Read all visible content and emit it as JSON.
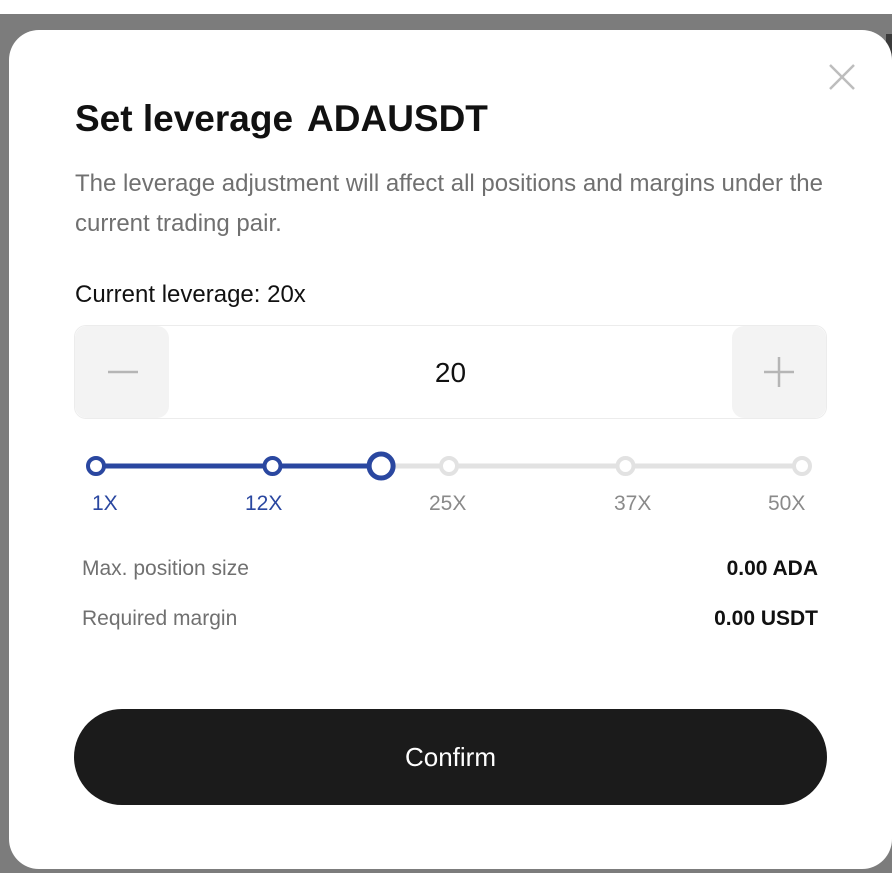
{
  "modal": {
    "title": "Set leverage",
    "pair": "ADAUSDT",
    "description": "The leverage adjustment will affect all positions and margins under the current trading pair.",
    "current_leverage": "Current leverage: 20x",
    "close_icon": "close-icon"
  },
  "stepper": {
    "value": "20",
    "minus_icon": "minus-icon",
    "plus_icon": "plus-icon"
  },
  "slider": {
    "min": 1,
    "max": 50,
    "value": 20,
    "marks": [
      "1X",
      "12X",
      "25X",
      "37X",
      "50X"
    ],
    "active_color": "#2a47a0",
    "inactive_color": "#e2e2e2"
  },
  "info": {
    "max_position_label": "Max. position size",
    "max_position_value": "0.00 ADA",
    "required_margin_label": "Required margin",
    "required_margin_value": "0.00 USDT"
  },
  "actions": {
    "confirm_label": "Confirm"
  }
}
